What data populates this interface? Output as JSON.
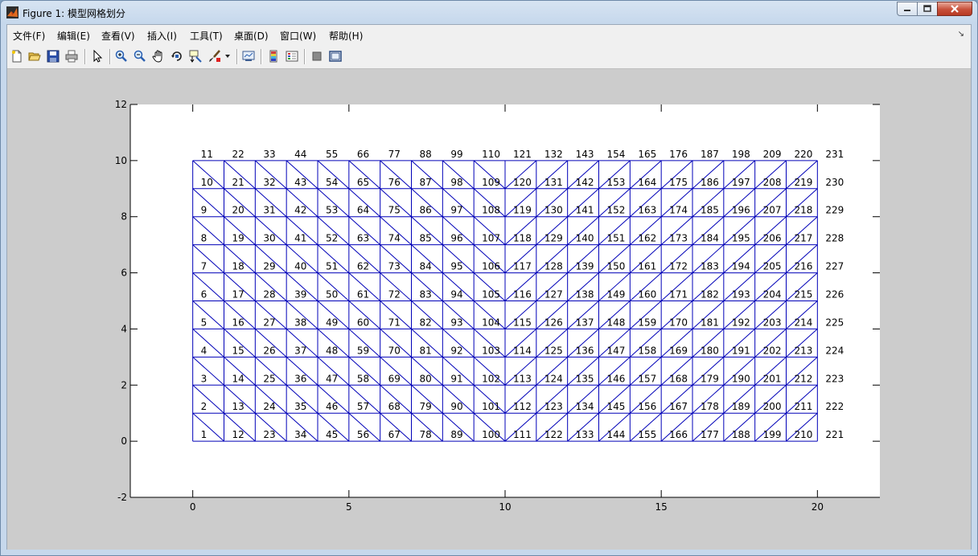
{
  "window": {
    "title": "Figure 1: 模型网格划分"
  },
  "menu": [
    "文件(F)",
    "编辑(E)",
    "查看(V)",
    "插入(I)",
    "工具(T)",
    "桌面(D)",
    "窗口(W)",
    "帮助(H)"
  ],
  "toolbar": {
    "icons": [
      "new-figure-icon",
      "open-file-icon",
      "save-icon",
      "print-icon",
      "edit-plot-arrow-icon",
      "zoom-in-icon",
      "zoom-out-icon",
      "pan-hand-icon",
      "rotate-3d-icon",
      "data-cursor-icon",
      "brush-icon",
      "brush-dropdown-icon",
      "link-plot-icon",
      "insert-colorbar-icon",
      "insert-legend-icon",
      "hide-plot-tools-icon",
      "show-plot-tools-icon"
    ]
  },
  "chart_data": {
    "type": "mesh",
    "title": "",
    "xlabel": "",
    "ylabel": "",
    "xlim": [
      -2,
      22
    ],
    "ylim": [
      -2,
      12
    ],
    "xticks": [
      0,
      5,
      10,
      15,
      20
    ],
    "yticks": [
      -2,
      0,
      2,
      4,
      6,
      8,
      10,
      12
    ],
    "mesh": {
      "x_nodes": [
        0,
        1,
        2,
        3,
        4,
        5,
        6,
        7,
        8,
        9,
        10,
        11,
        12,
        13,
        14,
        15,
        16,
        17,
        18,
        19,
        20
      ],
      "y_nodes": [
        0,
        1,
        2,
        3,
        4,
        5,
        6,
        7,
        8,
        9,
        10
      ],
      "node_numbering": "column-wise from bottom-left, 11 nodes per column, 1 to 231",
      "node_count": 231,
      "diagonals": "left half (x<10): from upper-left to lower-right; right half (x>=10): from lower-left to upper-right",
      "line_color": "#0000b8"
    }
  },
  "colors": {
    "mesh": "#0000b8",
    "axes_bg": "#ffffff",
    "figure_bg": "#cccccc"
  }
}
